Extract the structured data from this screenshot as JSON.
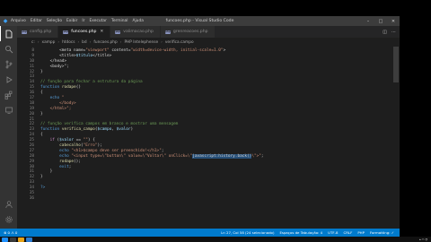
{
  "window": {
    "title": "funcoes.php - Visual Studio Code",
    "menu": [
      "Arquivo",
      "Editar",
      "Seleção",
      "Exibir",
      "Ir",
      "Executar",
      "Terminal",
      "Ajuda"
    ]
  },
  "tabs": [
    {
      "label": "config.php",
      "active": false
    },
    {
      "label": "funcoes.php",
      "active": true
    },
    {
      "label": "valimacao.php",
      "active": false
    },
    {
      "label": "grenreacoes.php",
      "active": false
    }
  ],
  "breadcrumbs": [
    "c:",
    "xampp",
    "htdocs",
    "bd",
    "funcoes.php",
    "PHP Intelephense",
    "verifica.campo"
  ],
  "editor": {
    "line_numbers": [
      "8",
      "9",
      "10",
      "11",
      "12",
      "13",
      "14",
      "15",
      "16",
      "17",
      "18",
      "19",
      "20",
      "21",
      "22",
      "23",
      "24",
      "25",
      "26",
      "27",
      "28",
      "29",
      "30",
      "31",
      "32",
      "33",
      "34",
      "35",
      "36"
    ],
    "lines": [
      [
        {
          "c": "        <meta name=",
          "t": ""
        },
        {
          "c": "\"viewport\"",
          "t": "str"
        },
        {
          "c": " content=",
          "t": ""
        },
        {
          "c": "\"width=device-width, initial-scale=1.0\"",
          "t": "str"
        },
        {
          "c": ">",
          "t": ""
        }
      ],
      [
        {
          "c": "        <title>",
          "t": ""
        },
        {
          "c": "$titulo",
          "t": "var"
        },
        {
          "c": "</title>",
          "t": ""
        }
      ],
      [
        {
          "c": "    </head>",
          "t": ""
        }
      ],
      [
        {
          "c": "    <body>\";",
          "t": ""
        }
      ],
      [
        {
          "c": "}",
          "t": ""
        }
      ],
      [
        {
          "c": "",
          "t": ""
        }
      ],
      [
        {
          "c": "// função para fechar a estrutura da página",
          "t": "cm"
        }
      ],
      [
        {
          "c": "function",
          "t": "kw"
        },
        {
          "c": " ",
          "t": ""
        },
        {
          "c": "rodape",
          "t": "fn"
        },
        {
          "c": "()",
          "t": ""
        }
      ],
      [
        {
          "c": "{",
          "t": ""
        }
      ],
      [
        {
          "c": "    ",
          "t": ""
        },
        {
          "c": "echo",
          "t": "kw"
        },
        {
          "c": " \"",
          "t": "str"
        }
      ],
      [
        {
          "c": "        </body>",
          "t": "str"
        }
      ],
      [
        {
          "c": "    </html>\";",
          "t": "str"
        }
      ],
      [
        {
          "c": "}",
          "t": ""
        }
      ],
      [
        {
          "c": "",
          "t": ""
        }
      ],
      [
        {
          "c": "// função verifica campos em branco e mostrar uma mensagem",
          "t": "cm"
        }
      ],
      [
        {
          "c": "function",
          "t": "kw"
        },
        {
          "c": " ",
          "t": ""
        },
        {
          "c": "verifica_campo",
          "t": "fn"
        },
        {
          "c": "(",
          "t": ""
        },
        {
          "c": "$campo",
          "t": "var"
        },
        {
          "c": ", ",
          "t": ""
        },
        {
          "c": "$valor",
          "t": "var"
        },
        {
          "c": ")",
          "t": ""
        }
      ],
      [
        {
          "c": "{",
          "t": ""
        }
      ],
      [
        {
          "c": "    ",
          "t": ""
        },
        {
          "c": "if",
          "t": "ctl"
        },
        {
          "c": " (",
          "t": ""
        },
        {
          "c": "$valor",
          "t": "var"
        },
        {
          "c": " == ",
          "t": ""
        },
        {
          "c": "\"\"",
          "t": "str"
        },
        {
          "c": ") {",
          "t": ""
        }
      ],
      [
        {
          "c": "        ",
          "t": ""
        },
        {
          "c": "cabecalho",
          "t": "fn"
        },
        {
          "c": "(",
          "t": ""
        },
        {
          "c": "\"Erro\"",
          "t": "str"
        },
        {
          "c": ");",
          "t": ""
        }
      ],
      [
        {
          "c": "        ",
          "t": ""
        },
        {
          "c": "echo",
          "t": "kw"
        },
        {
          "c": " ",
          "t": ""
        },
        {
          "c": "\"<h1>$campo deve ser preenchido!</h1>\"",
          "t": "str"
        },
        {
          "c": ";",
          "t": ""
        }
      ],
      [
        {
          "c": "        ",
          "t": ""
        },
        {
          "c": "echo",
          "t": "kw"
        },
        {
          "c": " ",
          "t": ""
        },
        {
          "c": "\"<input type=\\\"button\\\" value=\\\"Voltar\\\" onClick=\\\"",
          "t": "str"
        },
        {
          "c": "javascript:history.back()",
          "t": "sel"
        },
        {
          "c": "\\\">\"",
          "t": "str"
        },
        {
          "c": ";",
          "t": ""
        }
      ],
      [
        {
          "c": "        ",
          "t": ""
        },
        {
          "c": "rodape",
          "t": "fn"
        },
        {
          "c": "();",
          "t": ""
        }
      ],
      [
        {
          "c": "        ",
          "t": ""
        },
        {
          "c": "exit",
          "t": "kw"
        },
        {
          "c": ";",
          "t": ""
        }
      ],
      [
        {
          "c": "    }",
          "t": ""
        }
      ],
      [
        {
          "c": "}",
          "t": ""
        }
      ],
      [
        {
          "c": "",
          "t": ""
        }
      ],
      [
        {
          "c": "?>",
          "t": "kw"
        }
      ],
      [
        {
          "c": "",
          "t": ""
        }
      ],
      [
        {
          "c": "",
          "t": ""
        }
      ]
    ]
  },
  "statusbar": {
    "left": [
      "⊗ 0 ⚠ 0"
    ],
    "right": [
      "Ln 27, Col 58 (24 selecionado)",
      "Espaços de Tabulação: 4",
      "UTF-8",
      "CRLF",
      "PHP",
      "Formatting: ✓"
    ]
  },
  "colors": {
    "accent": "#007acc",
    "editor_bg": "#1e1e1e",
    "activity_bg": "#333333",
    "titlebar_bg": "#3c3c3c"
  }
}
